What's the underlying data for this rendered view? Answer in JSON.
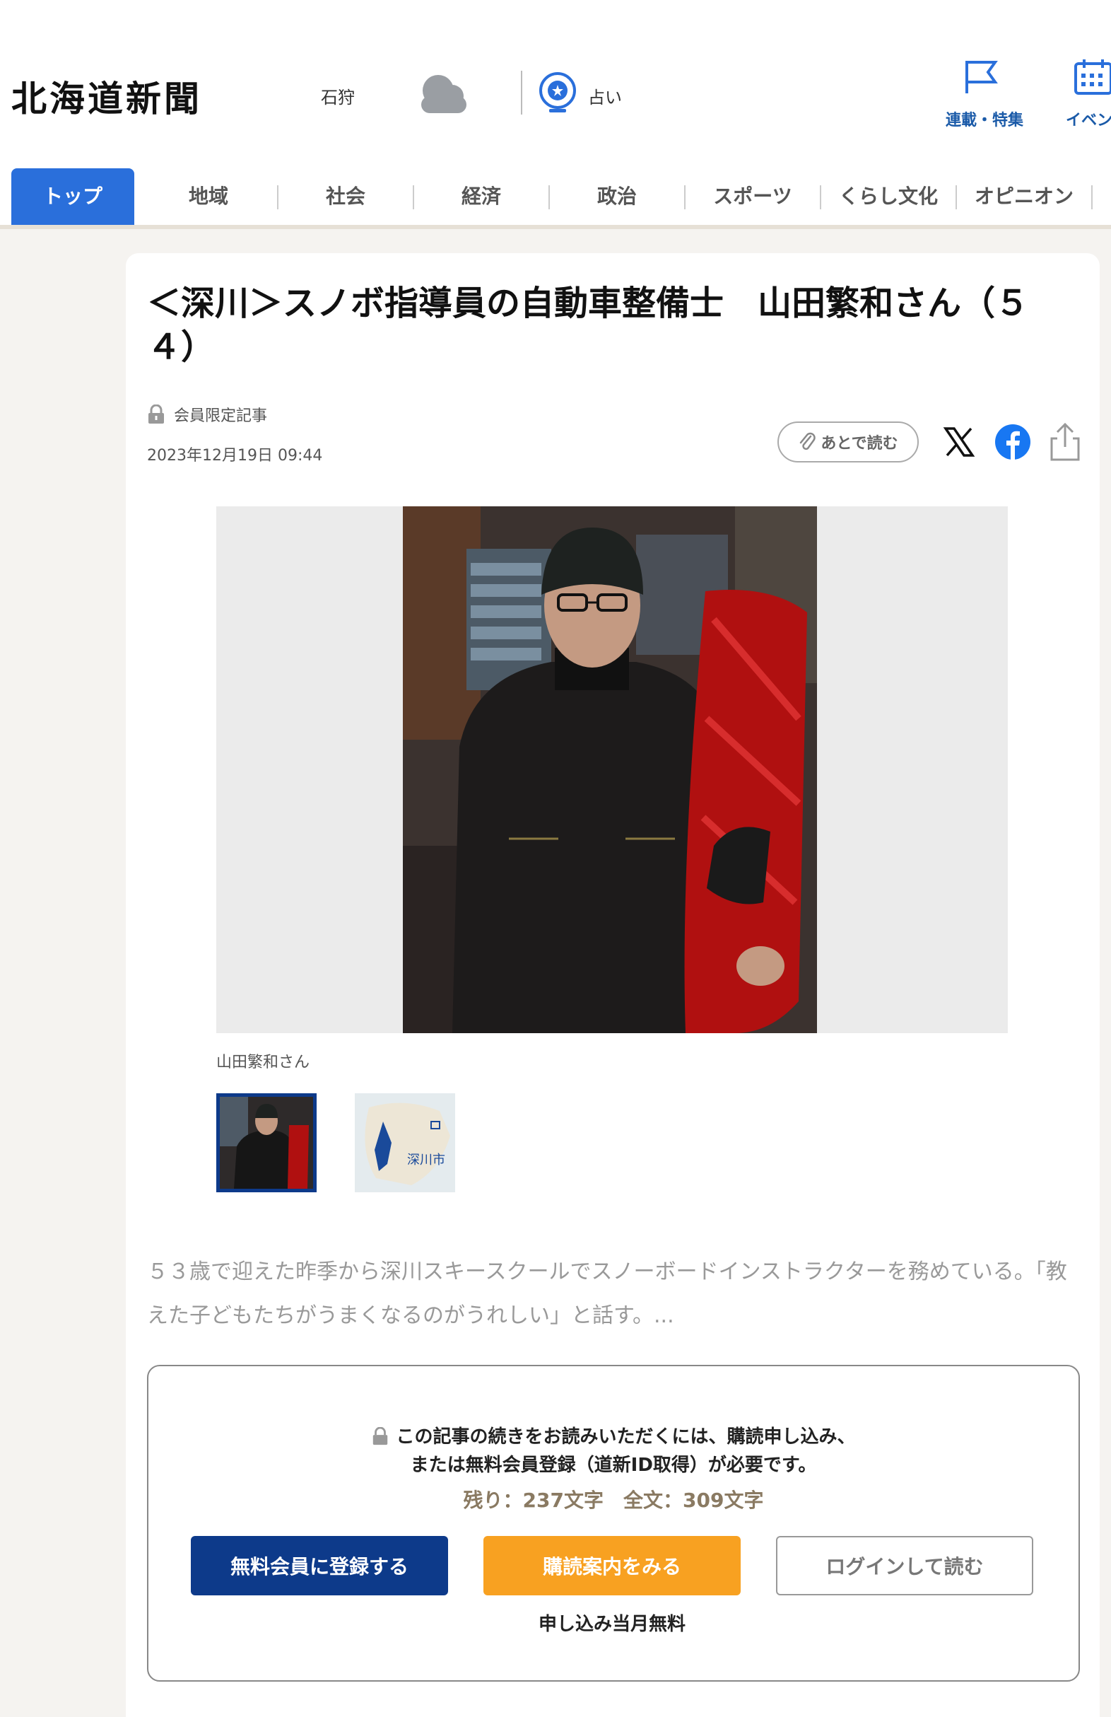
{
  "header": {
    "logo": "北海道新聞",
    "region": "石狩",
    "weather_icon": "cloud-icon",
    "fortune_label": "占い",
    "serial_label": "連載・特集",
    "event_label": "イベン"
  },
  "nav": {
    "items": [
      "トップ",
      "地域",
      "社会",
      "経済",
      "政治",
      "スポーツ",
      "くらし文化",
      "オピニオン"
    ],
    "active": "トップ"
  },
  "article": {
    "title": "＜深川＞スノボ指導員の自動車整備士　山田繁和さん（５４）",
    "member_label": "会員限定記事",
    "date": "2023年12月19日 09:44",
    "read_later": "あとで読む",
    "photo_caption": "山田繁和さん",
    "map_label": "深川市",
    "body": "５３歳で迎えた昨季から深川スキースクールでスノーボードインストラクターを務めている。「教えた子どもたちがうまくなるのがうれしい」と話す。..."
  },
  "paywall": {
    "message_line1": "この記事の続きをお読みいただくには、購読申し込み、",
    "message_line2": "または無料会員登録（道新ID取得）が必要です。",
    "counts": "残り：237文字　全文：309文字",
    "free_button": "無料会員に登録する",
    "subscribe_button": "購読案内をみる",
    "login_button": "ログインして読む",
    "subscribe_note": "申し込み当月無料"
  },
  "colors": {
    "accent_blue": "#2a6fdb",
    "navy": "#0d3a8a",
    "orange": "#f8a121",
    "facebook": "#1877f2"
  }
}
